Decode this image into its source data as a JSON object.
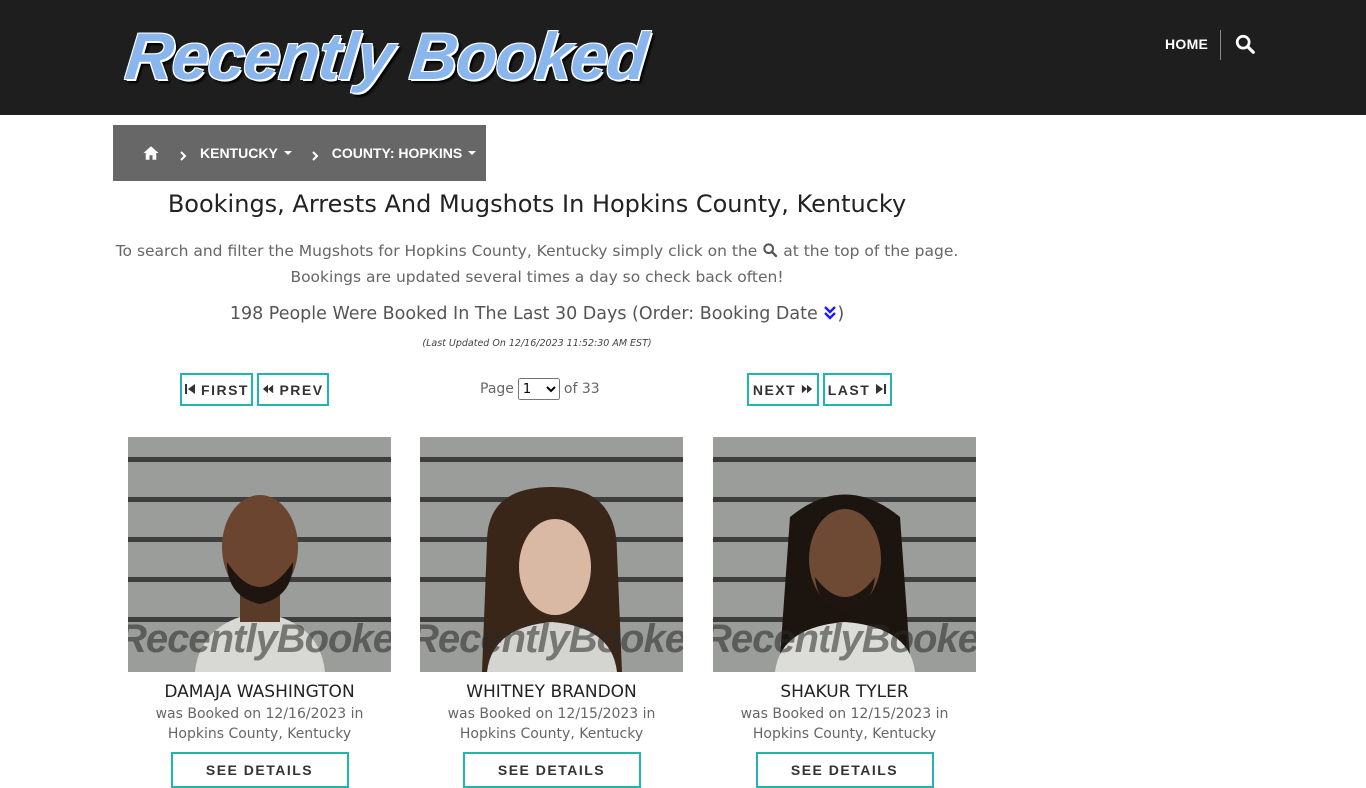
{
  "header": {
    "logo_text": "Recently Booked",
    "nav_home": "HOME",
    "search_icon": "search-icon"
  },
  "breadcrumb": {
    "home_icon": "home-icon",
    "items": [
      {
        "label": "KENTUCKY"
      },
      {
        "label": "COUNTY: HOPKINS"
      }
    ]
  },
  "main": {
    "title": "Bookings, Arrests And Mugshots In Hopkins County, Kentucky",
    "intro_part1": "To search and filter the Mugshots for Hopkins County, Kentucky simply click on the",
    "intro_part2": "at the top of the page.",
    "intro_line2": "Bookings are updated several times a day so check back often!",
    "count_text": "198 People Were Booked In The Last 30 Days (Order: Booking Date",
    "count_close": ")",
    "last_updated": "(Last Updated On 12/16/2023 11:52:30 AM EST)"
  },
  "pagination": {
    "first": "FIRST",
    "prev": "PREV",
    "next": "NEXT",
    "last": "LAST",
    "page_label": "Page",
    "current_page": "1",
    "of_label": "of 33"
  },
  "colors": {
    "accent": "#1fb6b2",
    "header_bg": "#1e1e1e",
    "breadcrumb_bg": "#676767"
  },
  "bookings": [
    {
      "name": "DAMAJA WASHINGTON",
      "booked_line1": "was Booked on 12/16/2023 in",
      "booked_line2": "Hopkins County, Kentucky",
      "button": "SEE DETAILS",
      "watermark": "RecentlyBooked.com"
    },
    {
      "name": "WHITNEY BRANDON",
      "booked_line1": "was Booked on 12/15/2023 in",
      "booked_line2": "Hopkins County, Kentucky",
      "button": "SEE DETAILS",
      "watermark": "RecentlyBooked.com"
    },
    {
      "name": "SHAKUR TYLER",
      "booked_line1": "was Booked on 12/15/2023 in",
      "booked_line2": "Hopkins County, Kentucky",
      "button": "SEE DETAILS",
      "watermark": "RecentlyBooked.com"
    }
  ]
}
